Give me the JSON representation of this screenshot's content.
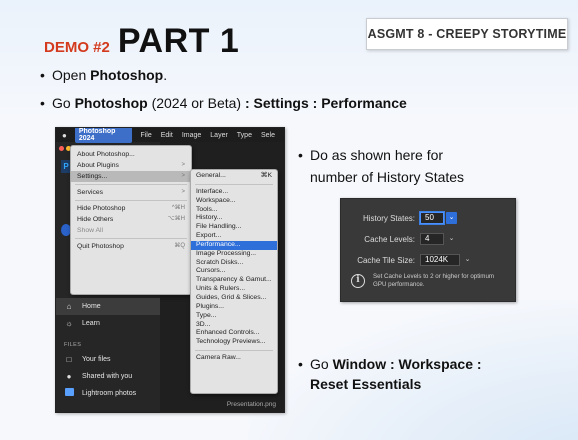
{
  "title": {
    "demo": "DEMO #2",
    "part": "PART 1"
  },
  "tag": "ASGMT 8 - CREEPY STORYTIME",
  "bullets": {
    "b1_pre": "Open ",
    "b1_bold": "Photoshop",
    "b1_post": ".",
    "b2_pre": "Go ",
    "b2_bold1": "Photoshop",
    "b2_mid": " (2024 or Beta) ",
    "b2_bold2": ": Settings : Performance",
    "b3_line1": "Do as shown here for",
    "b3_line2": "number of History States",
    "b4_pre": "Go ",
    "b4_bold1": "Window : Workspace :",
    "b4_bold2": "Reset Essentials"
  },
  "ps": {
    "menubar": [
      "Photoshop 2024",
      "File",
      "Edit",
      "Image",
      "Layer",
      "Type",
      "Sele"
    ],
    "menu": [
      {
        "label": "About Photoshop...",
        "shortcut": ""
      },
      {
        "label": "About Plugins",
        "shortcut": ">"
      },
      {
        "label": "Settings...",
        "shortcut": ">"
      },
      {
        "label": "Services",
        "shortcut": ">"
      },
      {
        "label": "Hide Photoshop",
        "shortcut": "^⌘H"
      },
      {
        "label": "Hide Others",
        "shortcut": "⌥⌘H"
      },
      {
        "label": "Show All",
        "shortcut": ""
      },
      {
        "label": "Quit Photoshop",
        "shortcut": "⌘Q"
      }
    ],
    "submenu": [
      {
        "label": "General...",
        "shortcut": "⌘K"
      },
      {
        "label": "Interface...",
        "shortcut": ""
      },
      {
        "label": "Workspace...",
        "shortcut": ""
      },
      {
        "label": "Tools...",
        "shortcut": ""
      },
      {
        "label": "History...",
        "shortcut": ""
      },
      {
        "label": "File Handling...",
        "shortcut": ""
      },
      {
        "label": "Export...",
        "shortcut": ""
      },
      {
        "label": "Performance...",
        "shortcut": ""
      },
      {
        "label": "Image Processing...",
        "shortcut": ""
      },
      {
        "label": "Scratch Disks...",
        "shortcut": ""
      },
      {
        "label": "Cursors...",
        "shortcut": ""
      },
      {
        "label": "Transparency & Gamut...",
        "shortcut": ""
      },
      {
        "label": "Units & Rulers...",
        "shortcut": ""
      },
      {
        "label": "Guides, Grid & Slices...",
        "shortcut": ""
      },
      {
        "label": "Plugins...",
        "shortcut": ""
      },
      {
        "label": "Type...",
        "shortcut": ""
      },
      {
        "label": "3D...",
        "shortcut": ""
      },
      {
        "label": "Enhanced Controls...",
        "shortcut": ""
      },
      {
        "label": "Technology Previews...",
        "shortcut": ""
      },
      {
        "label": "Camera Raw...",
        "shortcut": ""
      }
    ],
    "nav": {
      "home": "Home",
      "learn": "Learn",
      "files_label": "FILES",
      "your_files": "Your files",
      "shared": "Shared with you",
      "lightroom": "Lightroom photos"
    },
    "bottom_file": "Presentation.png"
  },
  "perf": {
    "history_label": "History States:",
    "history_value": "50",
    "cache_label": "Cache Levels:",
    "cache_value": "4",
    "tile_label": "Cache Tile Size:",
    "tile_value": "1024K",
    "note": "Set Cache Levels to 2 or higher for optimum GPU performance."
  },
  "colors": {
    "accent_red": "#d33a1e",
    "ps_blue": "#2e6fd9"
  }
}
